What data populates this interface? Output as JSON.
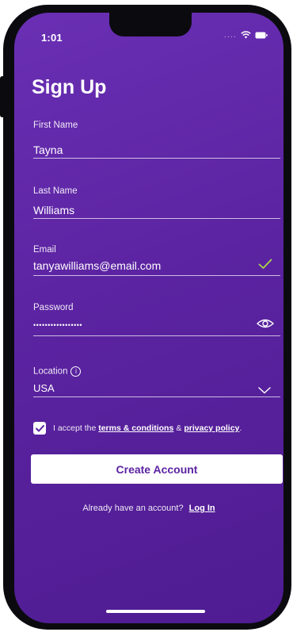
{
  "status_bar": {
    "time": "1:01",
    "signal": "...."
  },
  "title": "Sign Up",
  "form": {
    "first_name": {
      "label": "First Name",
      "value": "Tayna"
    },
    "last_name": {
      "label": "Last Name",
      "value": "Williams"
    },
    "email": {
      "label": "Email",
      "value": "tanyawilliams@email.com",
      "valid": true
    },
    "password": {
      "label": "Password",
      "value": "•••••••••••••••••"
    },
    "location": {
      "label": "Location",
      "value": "USA"
    }
  },
  "terms": {
    "checked": true,
    "prefix": "I accept the",
    "terms_link": "terms & conditions",
    "separator": "&",
    "privacy_link": "privacy policy",
    "suffix": "."
  },
  "create_button": "Create Account",
  "login": {
    "prompt": "Already have an account?",
    "link": "Log In"
  },
  "colors": {
    "background": "#5b23a1",
    "accent": "#ffffff",
    "valid_check": "#a8d84a"
  },
  "icons": [
    "wifi-icon",
    "battery-icon",
    "check-icon",
    "eye-icon",
    "info-icon",
    "chevron-down-icon",
    "checkbox-check-icon"
  ]
}
